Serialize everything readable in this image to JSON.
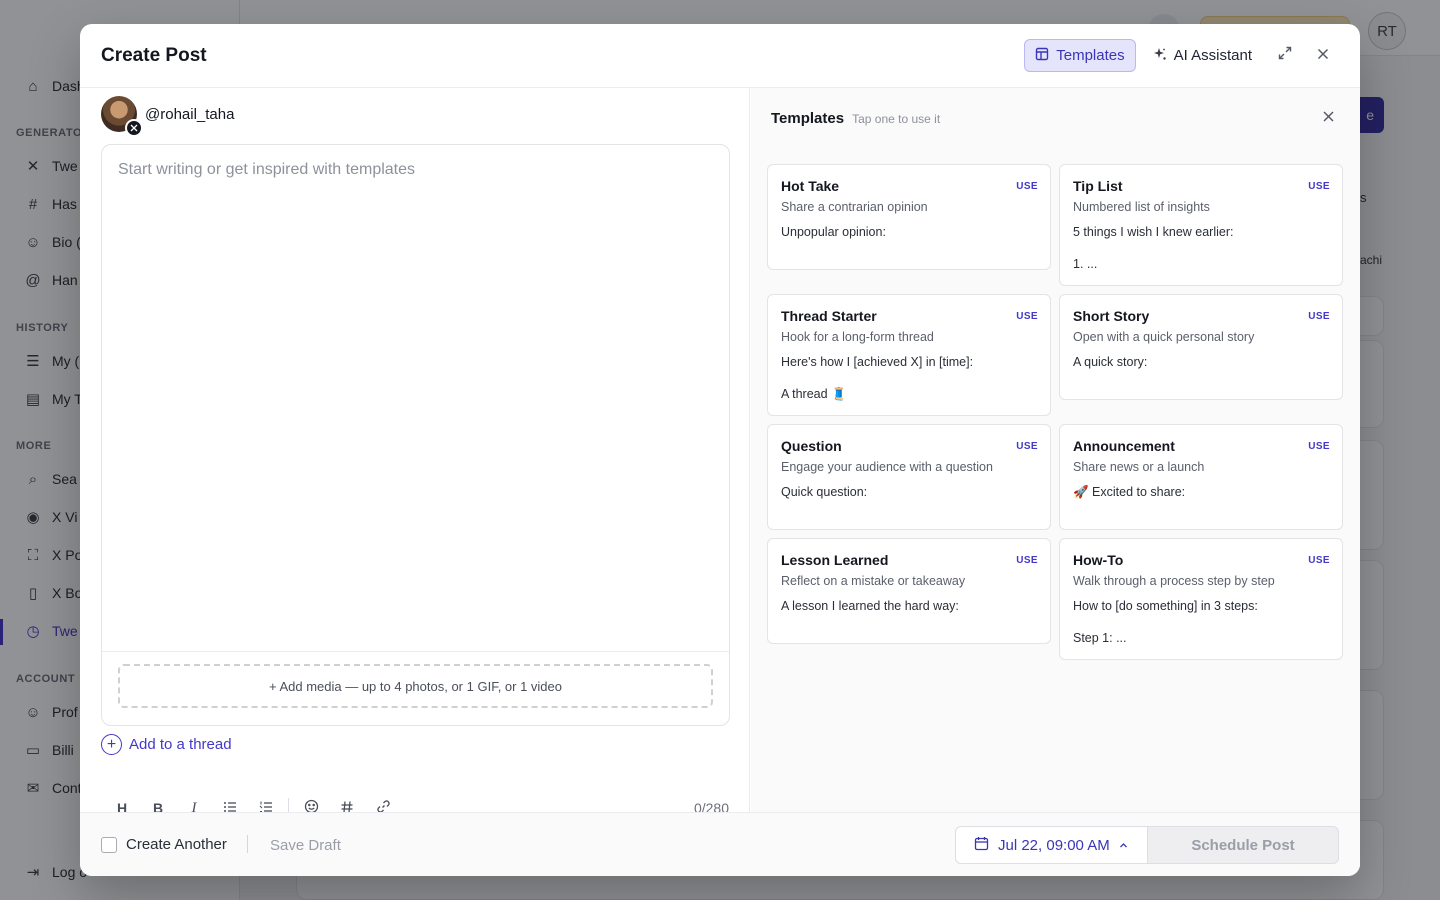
{
  "background": {
    "sidebar_sections": [
      "GENERATO",
      "HISTORY",
      "MORE",
      "ACCOUNT"
    ],
    "sidebar_items": [
      "Dash",
      "Twe",
      "Has",
      "Bio (",
      "Han",
      "My (",
      "My T",
      "Sea",
      "X Vi",
      "X Po",
      "X Bo",
      "Twe",
      "Prof",
      "Billi",
      "Cont",
      "Log o"
    ],
    "avatar_initials": "RT",
    "cta_label": "e",
    "side_texts": [
      "s",
      "achi"
    ]
  },
  "modal": {
    "title": "Create Post",
    "header": {
      "templates_label": "Templates",
      "ai_assistant_label": "AI Assistant"
    },
    "composer": {
      "handle": "@rohail_taha",
      "placeholder": "Start writing or get inspired with templates",
      "media_hint": "+ Add media — up to 4 photos, or 1 GIF, or 1 video",
      "add_thread_label": "Add to a thread",
      "char_count": "0/280",
      "toolbar": {
        "heading_label": "H",
        "bold_label": "B",
        "italic_label": "I"
      }
    },
    "templates_panel": {
      "title": "Templates",
      "subtitle": "Tap one to use it",
      "use_label": "USE",
      "items": [
        {
          "name": "Hot Take",
          "desc": "Share a contrarian opinion",
          "body": "Unpopular opinion:"
        },
        {
          "name": "Tip List",
          "desc": "Numbered list of insights",
          "body": "5 things I wish I knew earlier:\n\n1. ..."
        },
        {
          "name": "Thread Starter",
          "desc": "Hook for a long-form thread",
          "body": "Here's how I [achieved X] in [time]:\n\nA thread 🧵"
        },
        {
          "name": "Short Story",
          "desc": "Open with a quick personal story",
          "body": "A quick story:"
        },
        {
          "name": "Question",
          "desc": "Engage your audience with a question",
          "body": "Quick question:"
        },
        {
          "name": "Announcement",
          "desc": "Share news or a launch",
          "body": "🚀 Excited to share:"
        },
        {
          "name": "Lesson Learned",
          "desc": "Reflect on a mistake or takeaway",
          "body": "A lesson I learned the hard way:"
        },
        {
          "name": "How-To",
          "desc": "Walk through a process step by step",
          "body": "How to [do something] in 3 steps:\n\nStep 1: ..."
        }
      ]
    },
    "footer": {
      "create_another_label": "Create Another",
      "save_draft_label": "Save Draft",
      "date_label": "Jul 22, 09:00 AM",
      "schedule_label": "Schedule Post"
    }
  },
  "colors": {
    "accent": "#4338ca",
    "accent_soft": "#e4e4fb"
  },
  "icons": [
    "templates-icon",
    "sparkle-icon",
    "expand-icon",
    "close-icon",
    "x-logo-icon",
    "plus-circle-icon",
    "emoji-icon",
    "hashtag-icon",
    "link-icon",
    "bullet-list-icon",
    "numbered-list-icon",
    "calendar-icon",
    "chevron-up-icon"
  ]
}
